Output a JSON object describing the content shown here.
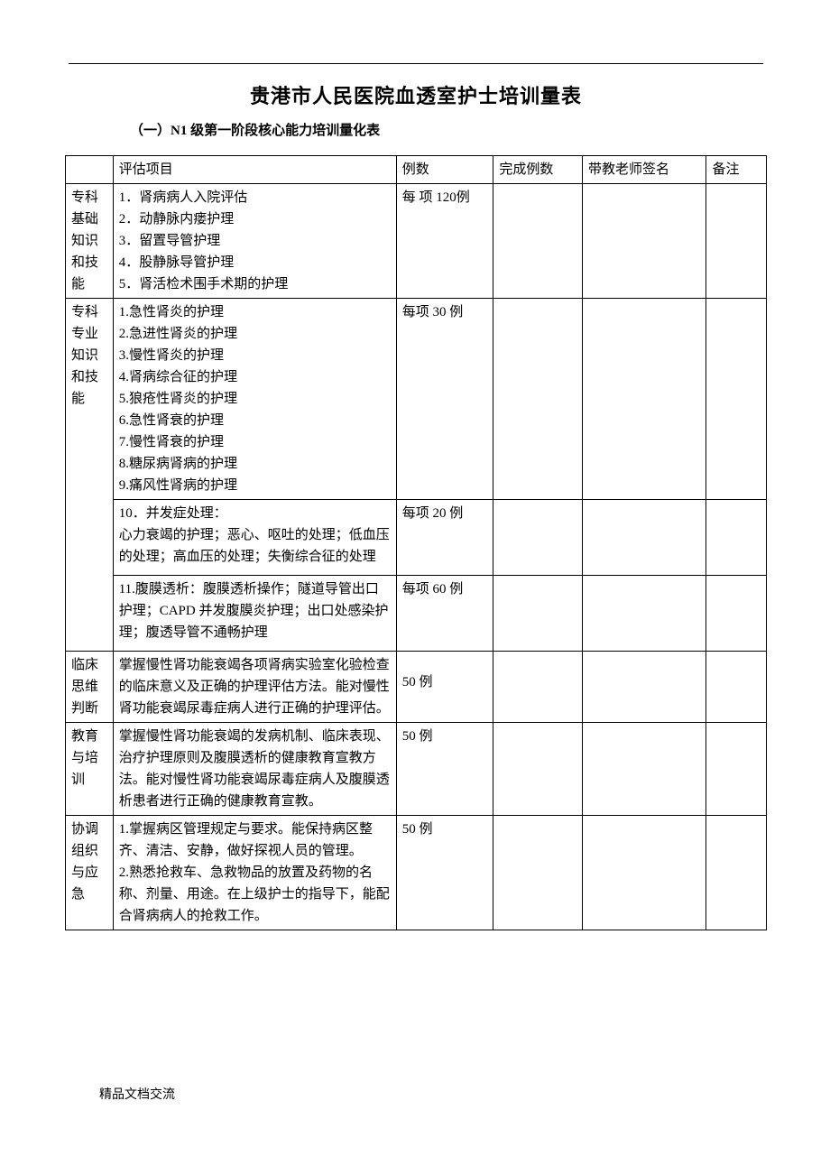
{
  "title": "贵港市人民医院血透室护士培训量表",
  "subtitle": "（一）N1 级第一阶段核心能力培训量化表",
  "header": {
    "col_item": "评估项目",
    "col_count": "例数",
    "col_done": "完成例数",
    "col_sign": "带教老师签名",
    "col_note": "备注"
  },
  "rows": [
    {
      "category": "专科基础知识和技能",
      "items": [
        "1．肾病病人入院评估",
        "2．动静脉内瘘护理",
        "3．留置导管护理",
        "4．股静脉导管护理",
        "5．肾活检术围手术期的护理"
      ],
      "count": "每 项 120例"
    },
    {
      "category": "专科专业知识和技能",
      "subrows": [
        {
          "items": [
            "1.急性肾炎的护理",
            "2.急进性肾炎的护理",
            "3.慢性肾炎的护理",
            "4.肾病综合征的护理",
            "5.狼疮性肾炎的护理",
            "6.急性肾衰的护理",
            "7.慢性肾衰的护理",
            "8.糖尿病肾病的护理",
            "9.痛风性肾病的护理"
          ],
          "count": "每项 30 例"
        },
        {
          "text": "10．并发症处理：\n心力衰竭的护理；恶心、呕吐的处理；低血压的处理；高血压的处理；失衡综合征的处理",
          "count": "每项 20 例"
        },
        {
          "text": "11.腹膜透析：腹膜透析操作；隧道导管出口护理；CAPD 并发腹膜炎护理；出口处感染护理；腹透导管不通畅护理",
          "count": "每项 60 例"
        }
      ]
    },
    {
      "category": "临床思维判断",
      "text": "掌握慢性肾功能衰竭各项肾病实验室化验检查的临床意义及正确的护理评估方法。能对慢性肾功能衰竭尿毒症病人进行正确的护理评估。",
      "count": "50 例"
    },
    {
      "category": "教育与培训",
      "text": "掌握慢性肾功能衰竭的发病机制、临床表现、治疗护理原则及腹膜透析的健康教育宣教方法。能对慢性肾功能衰竭尿毒症病人及腹膜透析患者进行正确的健康教育宣教。",
      "count": "50 例"
    },
    {
      "category": "协调组织与应急",
      "text": "1.掌握病区管理规定与要求。能保持病区整齐、清洁、安静，做好探视人员的管理。\n2.熟悉抢救车、急救物品的放置及药物的名称、剂量、用途。在上级护士的指导下，能配合肾病病人的抢救工作。",
      "count": "50 例"
    }
  ],
  "footer": "精品文档交流"
}
